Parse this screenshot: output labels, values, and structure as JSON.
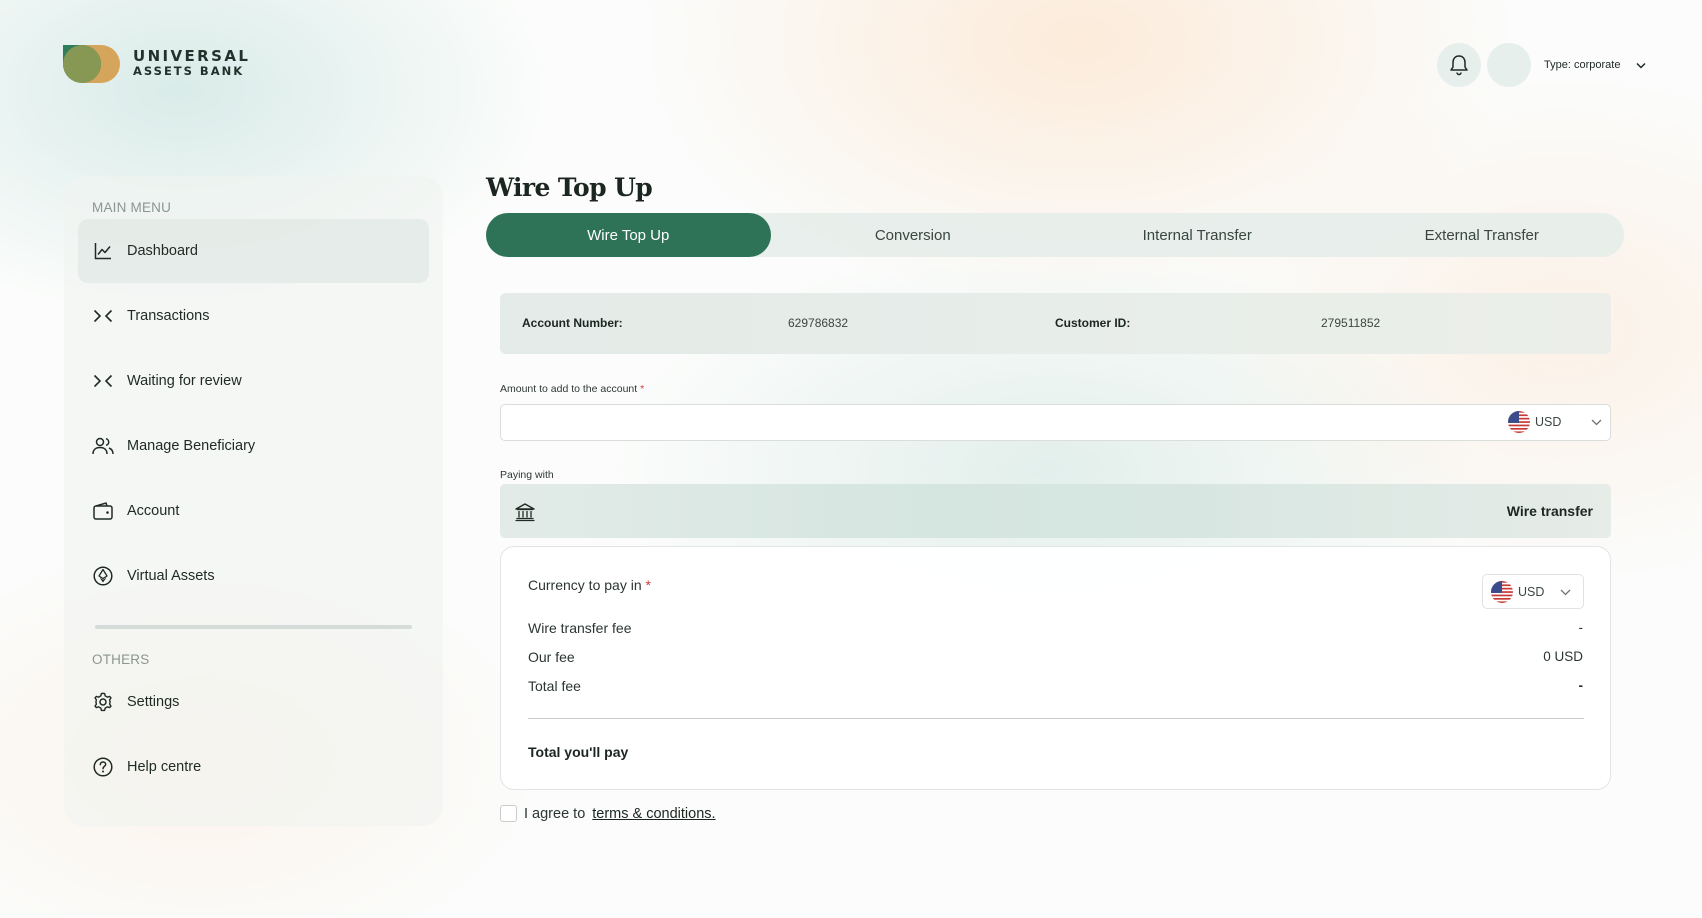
{
  "brand": {
    "name_line1": "UNIVERSAL",
    "name_line2": "ASSETS BANK"
  },
  "header": {
    "account_type": "Type: corporate"
  },
  "sidebar": {
    "main_heading": "MAIN MENU",
    "items": [
      {
        "label": "Dashboard",
        "icon": "chart-line-icon",
        "active": true
      },
      {
        "label": "Transactions",
        "icon": "arrows-icon"
      },
      {
        "label": "Waiting for review",
        "icon": "arrows-icon"
      },
      {
        "label": "Manage Beneficiary",
        "icon": "users-icon"
      },
      {
        "label": "Account",
        "icon": "wallet-icon"
      },
      {
        "label": "Virtual Assets",
        "icon": "crypto-icon"
      }
    ],
    "others_heading": "OTHERS",
    "others": [
      {
        "label": "Settings",
        "icon": "gear-icon"
      },
      {
        "label": "Help centre",
        "icon": "help-icon"
      }
    ]
  },
  "page": {
    "title": "Wire Top Up"
  },
  "tabs": [
    {
      "label": "Wire Top Up",
      "active": true
    },
    {
      "label": "Conversion"
    },
    {
      "label": "Internal Transfer"
    },
    {
      "label": "External Transfer"
    }
  ],
  "account_info": {
    "account_number_label": "Account Number:",
    "account_number": "629786832",
    "customer_id_label": "Customer ID:",
    "customer_id": "279511852"
  },
  "amount_field": {
    "label": "Amount to add to the account",
    "required_mark": "*",
    "value": "",
    "currency": "USD"
  },
  "paying_with": {
    "label": "Paying with",
    "method": "Wire transfer"
  },
  "summary": {
    "currency_label": "Currency to pay in",
    "required_mark": "*",
    "currency": "USD",
    "rows": [
      {
        "label": "Wire transfer fee",
        "value": "-"
      },
      {
        "label": "Our fee",
        "value": "0 USD"
      },
      {
        "label": "Total fee",
        "value": "-"
      }
    ],
    "total_label": "Total you'll pay"
  },
  "agreement": {
    "prefix": "I agree to",
    "link": "terms & conditions."
  },
  "colors": {
    "primary": "#2e7358",
    "brand_green": "#2f7d5a",
    "brand_gold": "#d4a55b",
    "required": "#d33a3a"
  }
}
